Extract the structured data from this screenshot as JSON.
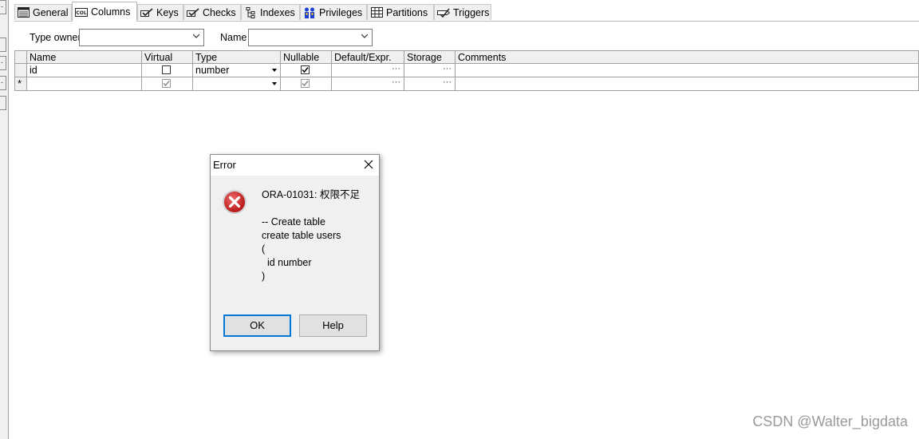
{
  "tabs": [
    {
      "label": "General",
      "icon": "general-table-icon"
    },
    {
      "label": "Columns",
      "icon": "columns-icon",
      "active": true
    },
    {
      "label": "Keys",
      "icon": "keys-icon"
    },
    {
      "label": "Checks",
      "icon": "checks-icon"
    },
    {
      "label": "Indexes",
      "icon": "indexes-icon"
    },
    {
      "label": "Privileges",
      "icon": "privileges-icon"
    },
    {
      "label": "Partitions",
      "icon": "partitions-icon"
    },
    {
      "label": "Triggers",
      "icon": "triggers-icon"
    }
  ],
  "columns_icon_text": "COL",
  "form": {
    "type_owner_label": "Type owner",
    "type_owner_value": "",
    "name_label": "Name",
    "name_value": ""
  },
  "grid": {
    "headers": [
      "Name",
      "Virtual",
      "Type",
      "Nullable",
      "Default/Expr.",
      "Storage",
      "Comments"
    ],
    "rows": [
      {
        "indicator": "",
        "name": "id",
        "virtual": false,
        "type": "number",
        "nullable": true,
        "default": "",
        "storage": "",
        "comments": ""
      },
      {
        "indicator": "*",
        "name": "",
        "virtual": true,
        "type": "",
        "nullable": true,
        "default": "",
        "storage": "",
        "comments": ""
      }
    ],
    "ellipsis": "···"
  },
  "dialog": {
    "title": "Error",
    "error_line": "ORA-01031: 权限不足",
    "sql_lines": [
      "-- Create table",
      "create table users",
      "(",
      "  id number",
      ")"
    ],
    "ok_label": "OK",
    "help_label": "Help"
  },
  "watermark": "CSDN @Walter_bigdata"
}
